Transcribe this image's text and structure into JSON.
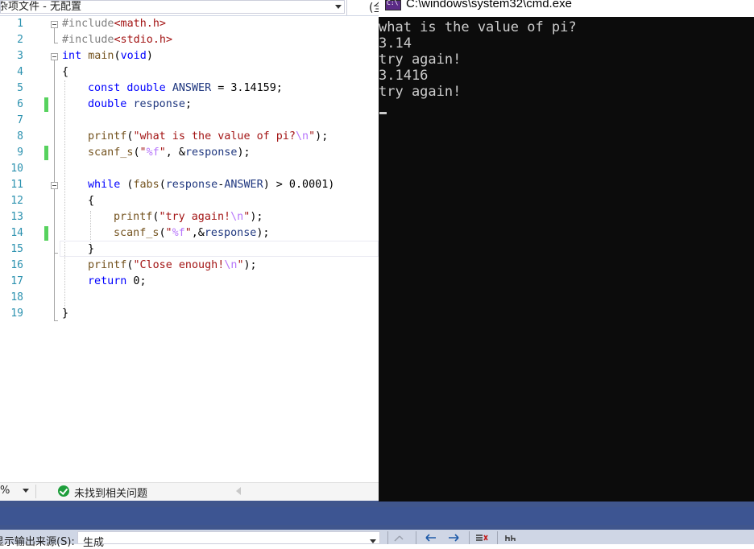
{
  "vs": {
    "project_combo": "杂项文件 - 无配置",
    "topbar_right": "(全"
  },
  "editor": {
    "line_numbers": [
      "1",
      "2",
      "3",
      "4",
      "5",
      "6",
      "7",
      "8",
      "9",
      "10",
      "11",
      "12",
      "13",
      "14",
      "15",
      "16",
      "17",
      "18",
      "19"
    ]
  },
  "status": {
    "zoom": "%",
    "issues": "未找到相关问题"
  },
  "output": {
    "source_label": "显示输出来源(S):",
    "source_value": "生成"
  },
  "cmd": {
    "title": "C:\\windows\\system32\\cmd.exe",
    "icon_text": "C:\\",
    "lines": [
      "what is the value of pi?",
      "3.14",
      "try again!",
      "3.1416",
      "try again!"
    ]
  },
  "colors": {
    "keyword": "#0000ff",
    "string": "#a31515",
    "line_number": "#2b91af",
    "console_bg": "#0c0c0c",
    "console_text": "#cccccc",
    "change_marker": "#57d25e",
    "vs_frame": "#40568d"
  },
  "icons": [
    "chevron-down-icon",
    "check-circle-icon",
    "scroll-left-icon",
    "console-app-icon",
    "find-in-output-icon",
    "prev-message-icon",
    "next-message-icon",
    "clear-all-icon",
    "word-wrap-icon"
  ]
}
